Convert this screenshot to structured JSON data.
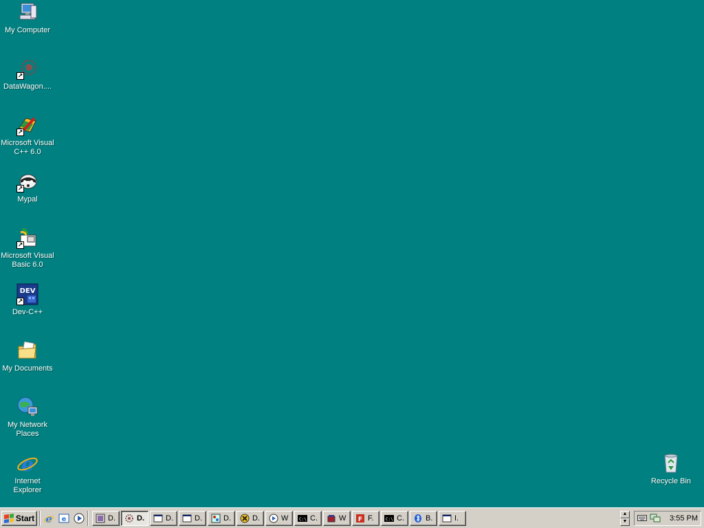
{
  "desktop": {
    "background": "#008080",
    "icons": [
      {
        "label": "My Computer"
      },
      {
        "label": "DataWagon...."
      },
      {
        "label": "Microsoft Visual C++ 6.0"
      },
      {
        "label": "Mypal"
      },
      {
        "label": "Microsoft Visual Basic 6.0"
      },
      {
        "label": "Dev-C++"
      },
      {
        "label": "My Documents"
      },
      {
        "label": "My Network Places"
      },
      {
        "label": "Internet Explorer"
      },
      {
        "label": "Recycle Bin"
      }
    ]
  },
  "taskbar": {
    "start_label": "Start",
    "quick_launch": [
      "internet-explorer-icon",
      "outlook-express-icon",
      "media-player-icon"
    ],
    "tasks": [
      {
        "label": "D.",
        "icon": "vc-project-icon"
      },
      {
        "label": "D.",
        "icon": "datawagon-icon"
      },
      {
        "label": "D.",
        "icon": "window-icon"
      },
      {
        "label": "D.",
        "icon": "window-icon"
      },
      {
        "label": "D.",
        "icon": "paint-icon"
      },
      {
        "label": "D.",
        "icon": "x-app-icon"
      },
      {
        "label": "W",
        "icon": "media-icon"
      },
      {
        "label": "C.",
        "icon": "console-icon"
      },
      {
        "label": "W",
        "icon": "winrar-icon"
      },
      {
        "label": "F.",
        "icon": "filezilla-icon"
      },
      {
        "label": "C.",
        "icon": "console-icon"
      },
      {
        "label": "B.",
        "icon": "bluetooth-icon"
      },
      {
        "label": "I.",
        "icon": "window-icon"
      }
    ],
    "active_task_index": 1,
    "clock": "3:55 PM"
  }
}
